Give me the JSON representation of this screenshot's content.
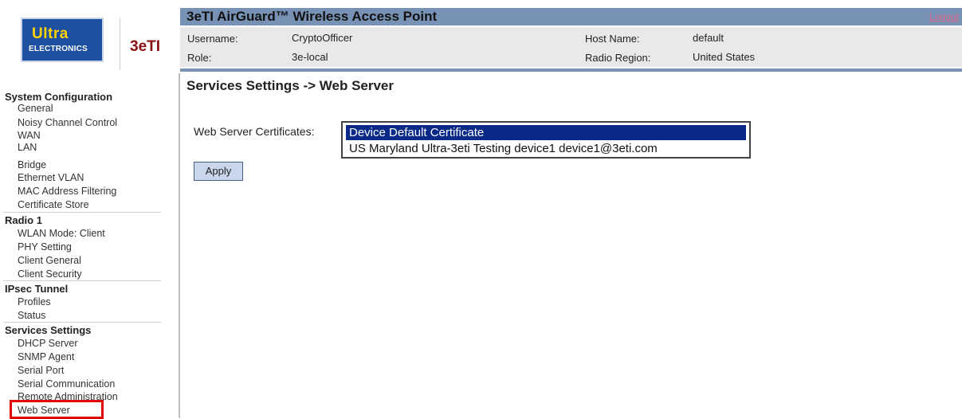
{
  "logo": {
    "ultra": "Ultra",
    "electronics": "ELECTRONICS",
    "brand": "3eTI"
  },
  "header": {
    "title": "3eTI AirGuard™ Wireless Access Point",
    "logout": "Logout",
    "info": {
      "username_label": "Username:",
      "username": "CryptoOfficer",
      "role_label": "Role:",
      "role": "3e-local",
      "host_label": "Host Name:",
      "host": "default",
      "region_label": "Radio Region:",
      "region": "United States"
    }
  },
  "sidebar": {
    "sections": [
      {
        "title": "System Configuration",
        "items": [
          "General",
          "Noisy Channel Control",
          "WAN",
          "LAN",
          "Bridge",
          "Ethernet VLAN",
          "MAC Address Filtering",
          "Certificate Store"
        ]
      },
      {
        "title": "Radio 1",
        "items": [
          "WLAN Mode: Client",
          "PHY Setting",
          "Client General",
          "Client Security"
        ]
      },
      {
        "title": "IPsec Tunnel",
        "items": [
          "Profiles",
          "Status"
        ]
      },
      {
        "title": "Services Settings",
        "items": [
          "DHCP Server",
          "SNMP Agent",
          "Serial Port",
          "Serial Communication",
          "Remote Administration",
          "Web Server"
        ]
      }
    ]
  },
  "main": {
    "title": "Services Settings -> Web Server",
    "cert_label": "Web Server Certificates:",
    "cert_options": [
      "Device Default Certificate",
      "US Maryland Ultra-3eti Testing device1 device1@3eti.com"
    ],
    "apply": "Apply"
  },
  "colors": {
    "header_blue": "#7892b5",
    "selection": "#0a2a8a",
    "highlight": "#e00000",
    "logo_blue": "#1e4fa0"
  }
}
